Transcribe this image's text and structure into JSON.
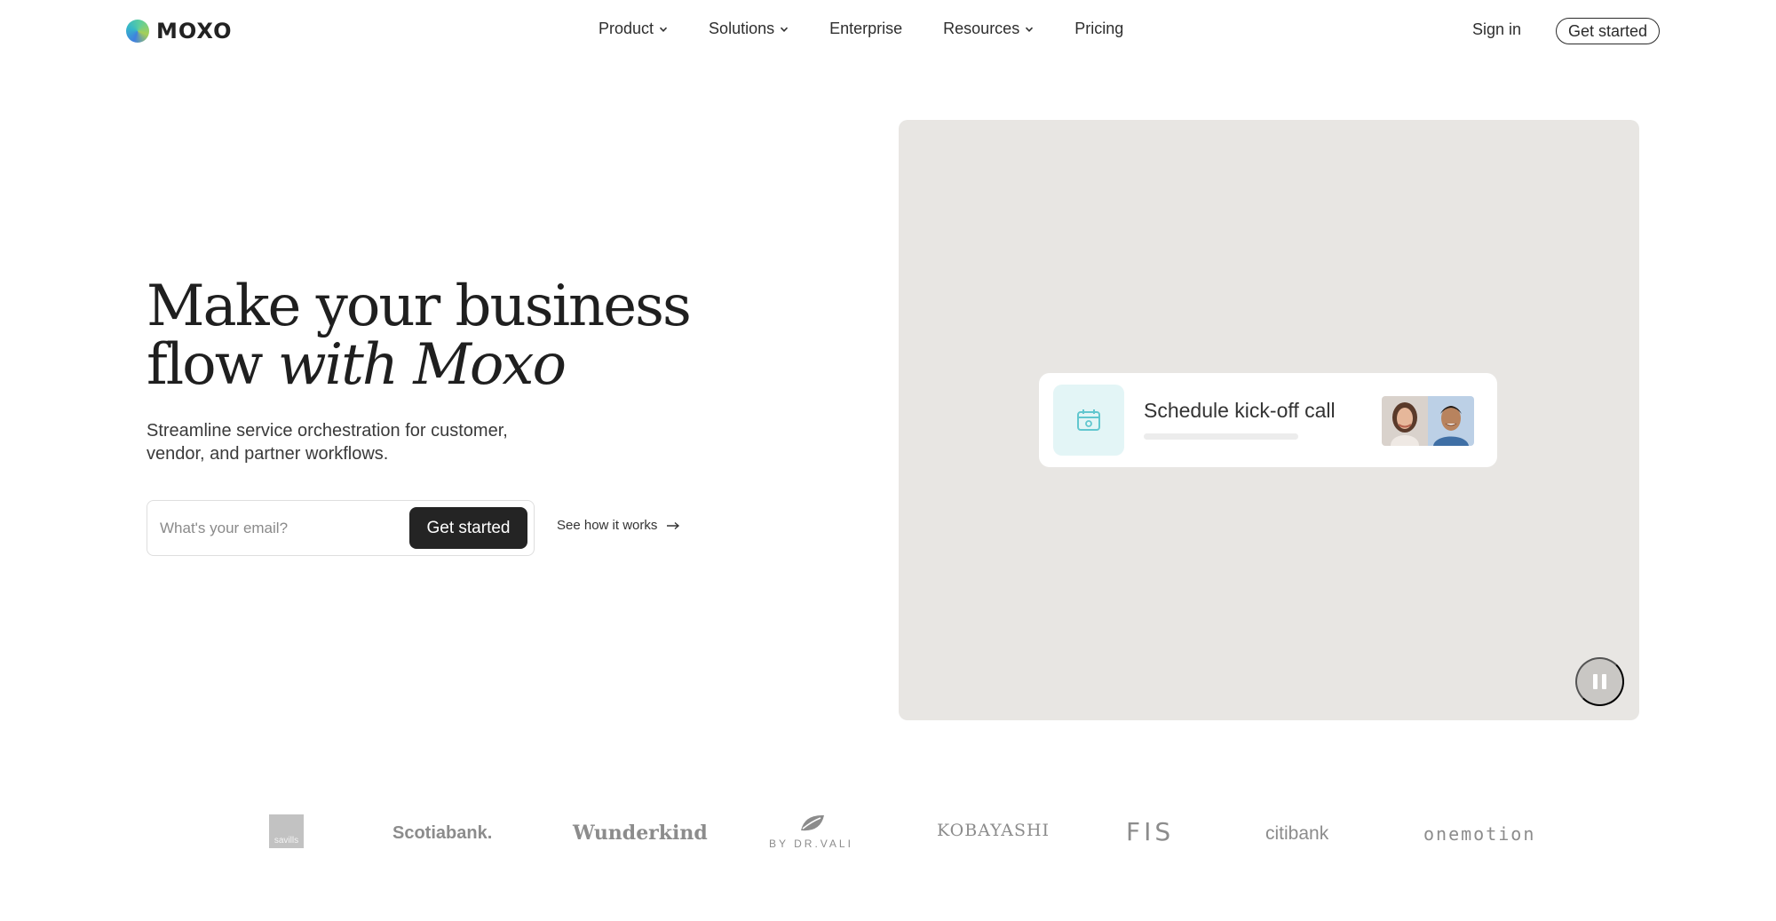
{
  "nav": {
    "logo_text": "MOXO",
    "links": [
      {
        "label": "Product",
        "has_dropdown": true
      },
      {
        "label": "Solutions",
        "has_dropdown": true
      },
      {
        "label": "Enterprise",
        "has_dropdown": false
      },
      {
        "label": "Resources",
        "has_dropdown": true
      },
      {
        "label": "Pricing",
        "has_dropdown": false
      }
    ],
    "sign_in": "Sign in",
    "cta": "Get started"
  },
  "hero": {
    "title_line1": "Make your business",
    "title_line2_plain": "flow ",
    "title_line2_italic": "with Moxo",
    "subtitle": "Streamline service orchestration for customer, vendor, and partner workflows.",
    "email_placeholder": "What's your email?",
    "email_button": "Get started",
    "secondary_link": "See how it works",
    "secondary_icon": "arrow-right-icon"
  },
  "media": {
    "task_title": "Schedule kick-off call",
    "task_icon": "calendar-icon",
    "pause_icon": "pause-icon"
  },
  "logos": [
    "savills",
    "Scotiabank.",
    "Wunderkind",
    "BY DR.VALI",
    "KOBAYASHI",
    "FIS",
    "citibank",
    "onemotion"
  ],
  "colors": {
    "text": "#2b2b2b",
    "cta_dark": "#242424",
    "media_bg": "#e8e6e3",
    "task_icon_bg": "#e3f5f6",
    "logo_gray": "#8c8c8c"
  }
}
